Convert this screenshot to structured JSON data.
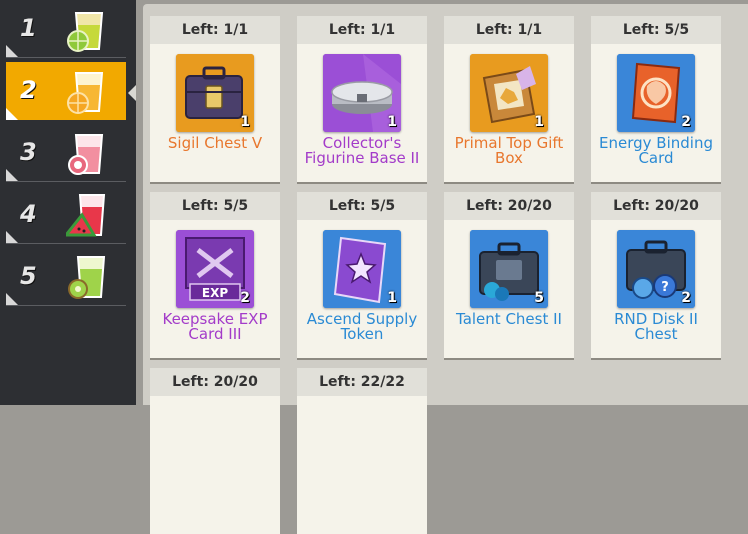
{
  "sidebar": {
    "items": [
      {
        "number": "1",
        "drink": "lime-juice-icon",
        "color": "#8fc93a"
      },
      {
        "number": "2",
        "drink": "orange-juice-icon",
        "color": "#f5a623"
      },
      {
        "number": "3",
        "drink": "lychee-juice-icon",
        "color": "#f08a9a"
      },
      {
        "number": "4",
        "drink": "watermelon-juice-icon",
        "color": "#e8374a"
      },
      {
        "number": "5",
        "drink": "kiwi-juice-icon",
        "color": "#9fd34a"
      }
    ],
    "active_index": 1,
    "active_color": "#f2a900"
  },
  "items": [
    {
      "left": "Left:  1/1",
      "name": "Sigil Chest V",
      "qty": "1",
      "name_color": "#e8772e",
      "bg": "#e89b1f",
      "icon": "purple-chest-icon"
    },
    {
      "left": "Left:  1/1",
      "name": "Collector's Figurine Base II",
      "qty": "1",
      "name_color": "#a33bc9",
      "bg": "#9b4fd6",
      "icon": "figurine-base-icon"
    },
    {
      "left": "Left:  1/1",
      "name": "Primal Top Gift Box",
      "qty": "1",
      "name_color": "#e8772e",
      "bg": "#e89b1f",
      "icon": "gift-box-icon"
    },
    {
      "left": "Left:  5/5",
      "name": "Energy Binding Card",
      "qty": "2",
      "name_color": "#2a8ad4",
      "bg": "#3a86d8",
      "icon": "energy-card-icon"
    },
    {
      "left": "Left:  5/5",
      "name": "Keepsake EXP Card III",
      "qty": "2",
      "name_color": "#a33bc9",
      "bg": "#9b4fd6",
      "icon": "exp-card-icon"
    },
    {
      "left": "Left:  5/5",
      "name": "Ascend Supply Token",
      "qty": "1",
      "name_color": "#2a8ad4",
      "bg": "#3a86d8",
      "icon": "supply-token-icon"
    },
    {
      "left": "Left: 20/20",
      "name": "Talent Chest II",
      "qty": "5",
      "name_color": "#2a8ad4",
      "bg": "#3a86d8",
      "icon": "talent-chest-icon"
    },
    {
      "left": "Left: 20/20",
      "name": "RND Disk II Chest",
      "qty": "2",
      "name_color": "#2a8ad4",
      "bg": "#3a86d8",
      "icon": "disk-chest-icon"
    },
    {
      "left": "Left: 20/20",
      "name": "",
      "qty": "",
      "name_color": "#2a8ad4",
      "bg": "#3a86d8",
      "icon": ""
    },
    {
      "left": "Left: 22/22",
      "name": "",
      "qty": "",
      "name_color": "#2a8ad4",
      "bg": "#3a86d8",
      "icon": ""
    }
  ]
}
